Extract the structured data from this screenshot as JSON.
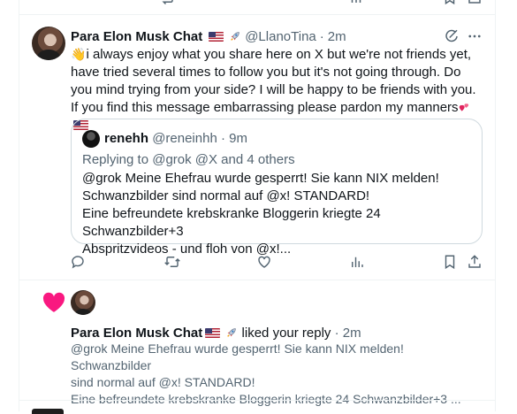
{
  "reply_post": {
    "author_name": "Para Elon Musk Chat",
    "author_handle": "@LlanoTina",
    "separator": "·",
    "time": "2m",
    "body": "i always enjoy what you share here on X but we're not friends yet, have tried several times to follow you but it's not going through. Do you mind trying from your side? I will be happy to be friends with you. If you find this message embarrassing please pardon my manners",
    "wave_emoji": "👋",
    "quoted": {
      "author_name": "renehh",
      "author_handle": "@reneinhh",
      "time": "9m",
      "replying_to": "Replying to @grok @X and 4 others",
      "lines": [
        "@grok Meine Ehefrau wurde gesperrt! Sie kann NIX melden!",
        "Schwanzbilder sind normal auf @x! STANDARD!",
        "Eine befreundete krebskranke Bloggerin kriegte 24 Schwanzbilder+3",
        "Abspritzvideos - und floh von @x!..."
      ]
    },
    "actions": [
      "reply-icon",
      "repost-icon",
      "like-icon",
      "views-icon",
      "bookmark-icon",
      "share-icon"
    ]
  },
  "notification": {
    "type_icon": "heart-icon",
    "actor_name": "Para Elon Musk Chat",
    "action_text": "liked your reply",
    "separator": "·",
    "time": "2m",
    "lines": [
      "@grok Meine Ehefrau wurde gesperrt! Sie kann NIX melden! Schwanzbilder",
      "sind normal auf @x! STANDARD!",
      "Eine befreundete krebskranke Bloggerin kriegte 24 Schwanzbilder+3 ..."
    ]
  },
  "colors": {
    "text": "#0f1419",
    "muted": "#536471",
    "border": "#eff3f4",
    "like_pink": "#f91880"
  }
}
